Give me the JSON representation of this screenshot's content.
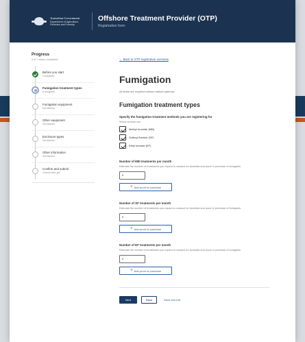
{
  "header": {
    "gov_line1": "Australian Government",
    "gov_line2a": "Department of Agriculture,",
    "gov_line2b": "Fisheries and Forestry",
    "title": "Offshore Treatment Provider (OTP)",
    "subtitle": "Registration form"
  },
  "sidebar": {
    "title": "Progress",
    "subtitle": "0 of 7 steps completed",
    "steps": [
      {
        "name": "Before you start",
        "status": "Completed",
        "state": "done"
      },
      {
        "name": "Fumigation treatment types",
        "status": "In progress",
        "state": "current"
      },
      {
        "name": "Fumigation equipment",
        "status": "Not started",
        "state": "todo"
      },
      {
        "name": "Other equipment",
        "status": "Not started",
        "state": "todo"
      },
      {
        "name": "Enclosure types",
        "status": "Not started",
        "state": "todo"
      },
      {
        "name": "Other information",
        "status": "Not started",
        "state": "todo"
      },
      {
        "name": "Confirm and submit",
        "status": "Cannot start yet",
        "state": "todo"
      }
    ]
  },
  "main": {
    "back_link": "← Back to OTP registration overview",
    "heading": "Fumigation",
    "intro": "All fields are required unless marked optional.",
    "section_heading": "Fumigation treatment types",
    "methods_label": "Specify the fumigation treatment methods you are registering for",
    "methods_hint": "Select at least one",
    "methods": [
      {
        "label": "Methyl bromide (MB)",
        "checked": true
      },
      {
        "label": "Sulfuryl fluoride (SF)",
        "checked": true
      },
      {
        "label": "Ethyl formate (EF)",
        "checked": true
      }
    ],
    "counts": [
      {
        "label": "Number of MB treatments per month",
        "hint": "Estimate the number of treatments you expect to conduct for Australia and proof of purchase of fumigants",
        "value": "0",
        "add_label": "Add proof of purchase"
      },
      {
        "label": "Number of SF treatments per month",
        "hint": "Estimate the number of treatments you expect to conduct for Australia and proof of purchase of fumigants",
        "value": "0",
        "add_label": "Add proof of purchase"
      },
      {
        "label": "Number of EF treatments per month",
        "hint": "Estimate the number of treatments you expect to conduct for Australia and proof of purchase of fumigants",
        "value": "0",
        "add_label": "Add proof of purchase"
      }
    ],
    "actions": {
      "next": "Next",
      "back": "Back",
      "save": "Save and exit"
    }
  },
  "colors": {
    "header_bg": "#1b3350",
    "link": "#2b5fa8",
    "primary_button": "#1b3a66",
    "done": "#2f7a3d"
  }
}
